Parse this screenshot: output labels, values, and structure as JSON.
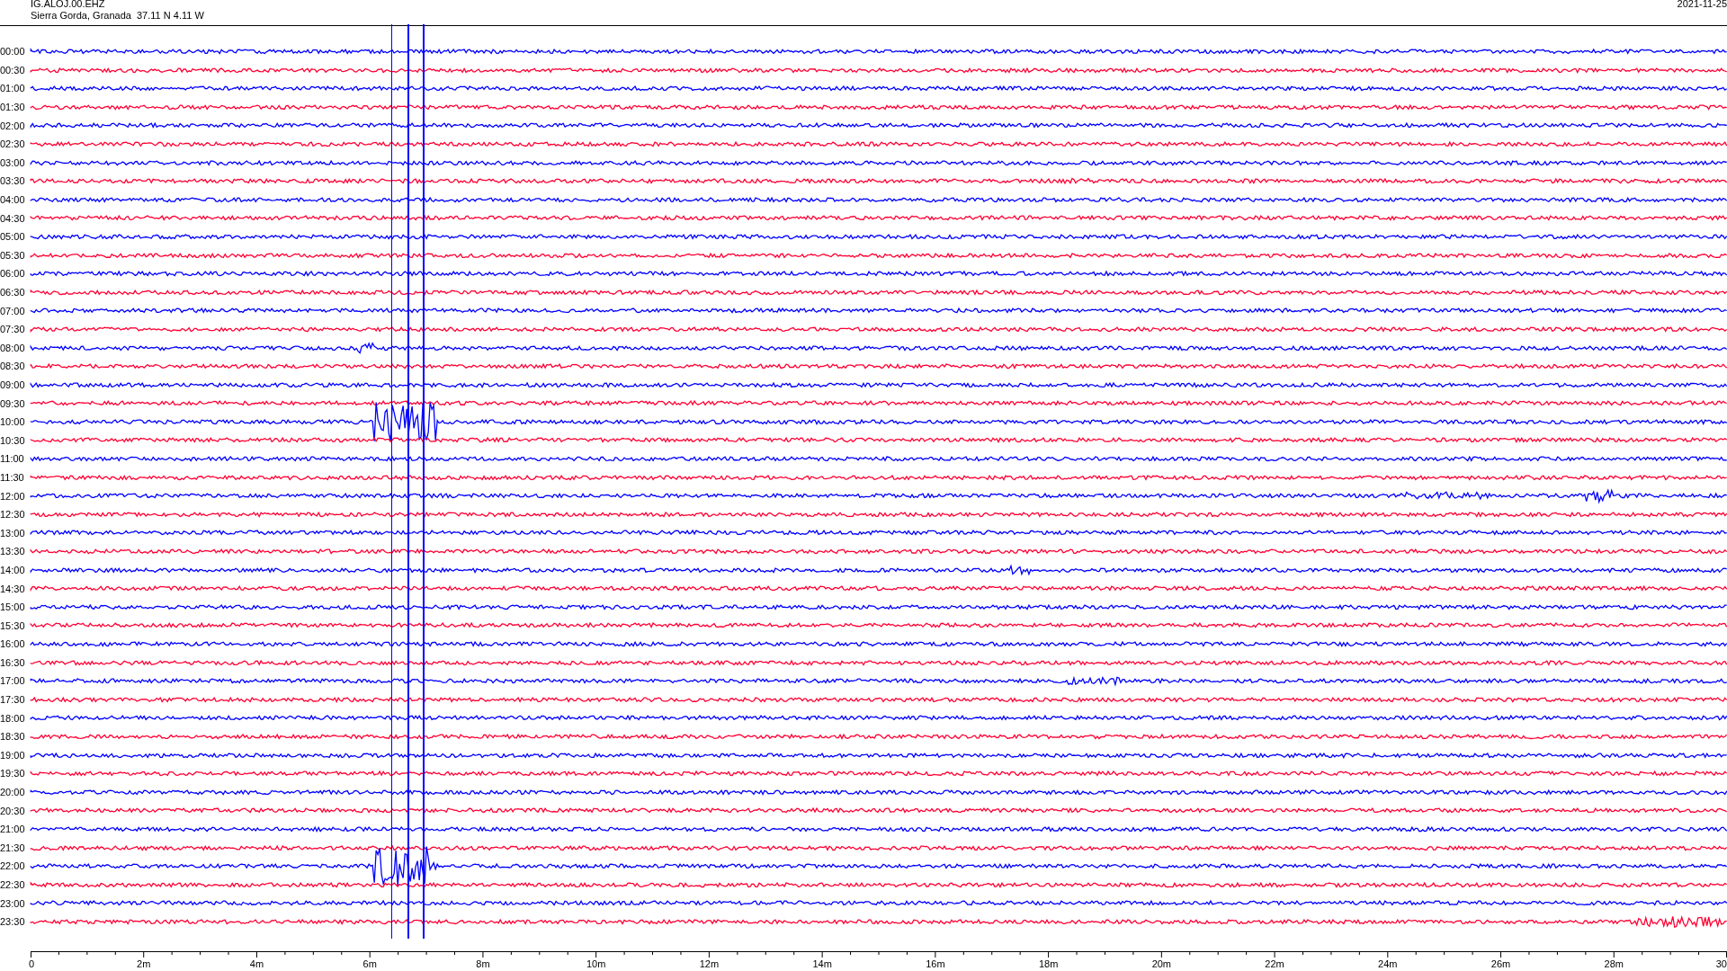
{
  "header": {
    "station": "IG.ALOJ.00.EHZ",
    "location": "Sierra Gorda, Granada  37.11 N 4.11 W",
    "date": "2021-11-25"
  },
  "traces": [
    {
      "time": "00:00",
      "color": "#0000ff"
    },
    {
      "time": "00:30",
      "color": "#ff0033"
    },
    {
      "time": "01:00",
      "color": "#0000ff"
    },
    {
      "time": "01:30",
      "color": "#ff0033"
    },
    {
      "time": "02:00",
      "color": "#0000ff"
    },
    {
      "time": "02:30",
      "color": "#ff0033"
    },
    {
      "time": "03:00",
      "color": "#0000ff"
    },
    {
      "time": "03:30",
      "color": "#ff0033"
    },
    {
      "time": "04:00",
      "color": "#0000ff"
    },
    {
      "time": "04:30",
      "color": "#ff0033"
    },
    {
      "time": "05:00",
      "color": "#0000ff"
    },
    {
      "time": "05:30",
      "color": "#ff0033"
    },
    {
      "time": "06:00",
      "color": "#0000ff"
    },
    {
      "time": "06:30",
      "color": "#ff0033"
    },
    {
      "time": "07:00",
      "color": "#0000ff"
    },
    {
      "time": "07:30",
      "color": "#ff0033"
    },
    {
      "time": "08:00",
      "color": "#0000ff"
    },
    {
      "time": "08:30",
      "color": "#ff0033"
    },
    {
      "time": "09:00",
      "color": "#0000ff"
    },
    {
      "time": "09:30",
      "color": "#ff0033"
    },
    {
      "time": "10:00",
      "color": "#0000ff"
    },
    {
      "time": "10:30",
      "color": "#ff0033"
    },
    {
      "time": "11:00",
      "color": "#0000ff"
    },
    {
      "time": "11:30",
      "color": "#ff0033"
    },
    {
      "time": "12:00",
      "color": "#0000ff"
    },
    {
      "time": "12:30",
      "color": "#ff0033"
    },
    {
      "time": "13:00",
      "color": "#0000ff"
    },
    {
      "time": "13:30",
      "color": "#ff0033"
    },
    {
      "time": "14:00",
      "color": "#0000ff"
    },
    {
      "time": "14:30",
      "color": "#ff0033"
    },
    {
      "time": "15:00",
      "color": "#0000ff"
    },
    {
      "time": "15:30",
      "color": "#ff0033"
    },
    {
      "time": "16:00",
      "color": "#0000ff"
    },
    {
      "time": "16:30",
      "color": "#ff0033"
    },
    {
      "time": "17:00",
      "color": "#0000ff"
    },
    {
      "time": "17:30",
      "color": "#ff0033"
    },
    {
      "time": "18:00",
      "color": "#0000ff"
    },
    {
      "time": "18:30",
      "color": "#ff0033"
    },
    {
      "time": "19:00",
      "color": "#0000ff"
    },
    {
      "time": "19:30",
      "color": "#ff0033"
    },
    {
      "time": "20:00",
      "color": "#0000ff"
    },
    {
      "time": "20:30",
      "color": "#ff0033"
    },
    {
      "time": "21:00",
      "color": "#0000ff"
    },
    {
      "time": "21:30",
      "color": "#ff0033"
    },
    {
      "time": "22:00",
      "color": "#0000ff"
    },
    {
      "time": "22:30",
      "color": "#ff0033"
    },
    {
      "time": "23:00",
      "color": "#0000ff"
    },
    {
      "time": "23:30",
      "color": "#ff0033"
    }
  ],
  "x_axis": {
    "tick_labels": [
      "0",
      "2m",
      "4m",
      "6m",
      "8m",
      "10m",
      "12m",
      "14m",
      "16m",
      "18m",
      "20m",
      "22m",
      "24m",
      "26m",
      "28m",
      "30"
    ]
  }
}
